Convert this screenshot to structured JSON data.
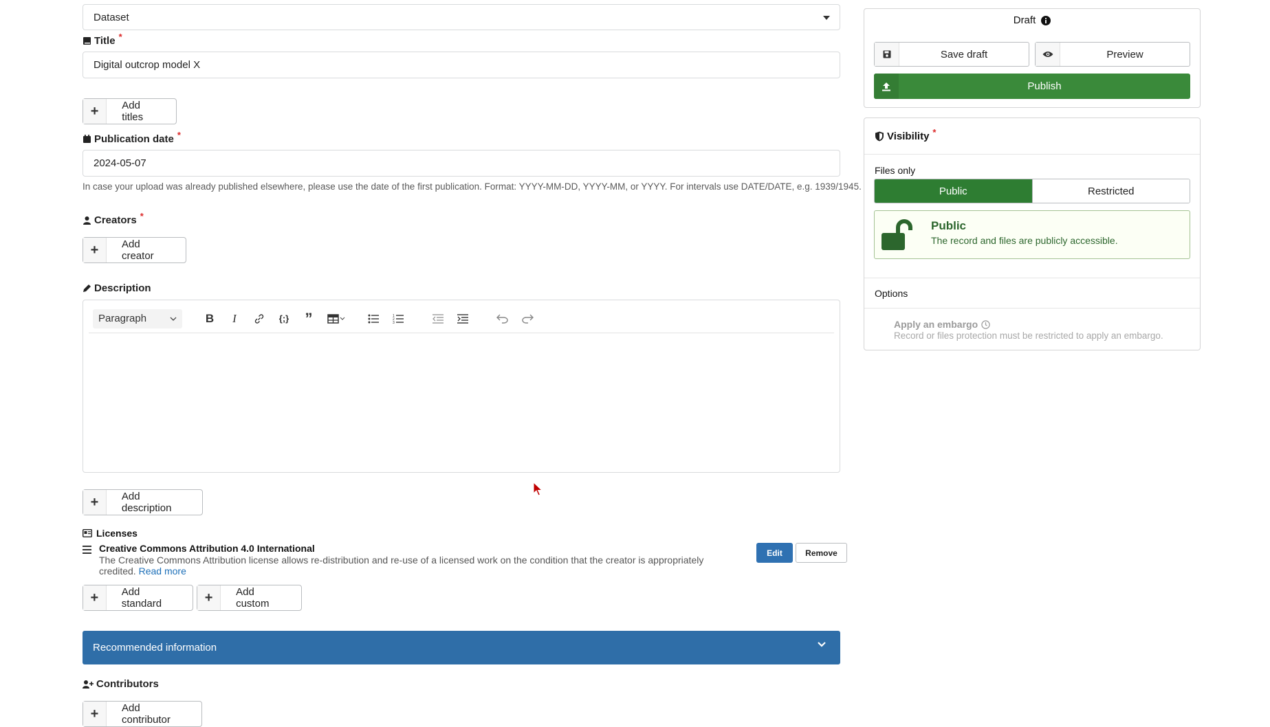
{
  "resource_type": {
    "value": "Dataset"
  },
  "title": {
    "label": "Title",
    "value": "Digital outcrop model X",
    "add_button": "Add titles"
  },
  "publication_date": {
    "label": "Publication date",
    "value": "2024-05-07",
    "help": "In case your upload was already published elsewhere, please use the date of the first publication. Format: YYYY-MM-DD, YYYY-MM, or YYYY. For intervals use DATE/DATE, e.g. 1939/1945."
  },
  "creators": {
    "label": "Creators",
    "add_button": "Add creator"
  },
  "description": {
    "label": "Description",
    "paragraph_select": "Paragraph",
    "add_button": "Add description"
  },
  "licenses": {
    "label": "Licenses",
    "items": [
      {
        "name": "Creative Commons Attribution 4.0 International",
        "description": "The Creative Commons Attribution license allows re-distribution and re-use of a licensed work on the condition that the creator is appropriately credited.",
        "read_more": "Read more",
        "edit": "Edit",
        "remove": "Remove"
      }
    ],
    "add_standard": "Add standard",
    "add_custom": "Add custom"
  },
  "recommended": {
    "label": "Recommended information"
  },
  "contributors": {
    "label": "Contributors",
    "add_button": "Add contributor"
  },
  "sidebar": {
    "status": "Draft",
    "save_draft": "Save draft",
    "preview": "Preview",
    "publish": "Publish",
    "visibility": {
      "label": "Visibility",
      "files_only": "Files only",
      "public": "Public",
      "restricted": "Restricted",
      "message_title": "Public",
      "message_text": "The record and files are publicly accessible.",
      "options": "Options",
      "embargo_label": "Apply an embargo",
      "embargo_help": "Record or files protection must be restricted to apply an embargo."
    }
  },
  "required_marker": "*",
  "colors": {
    "primary": "#2f6ea8",
    "publish": "#3a8a3a",
    "public_on": "#2e7d32",
    "required": "#db2828"
  }
}
